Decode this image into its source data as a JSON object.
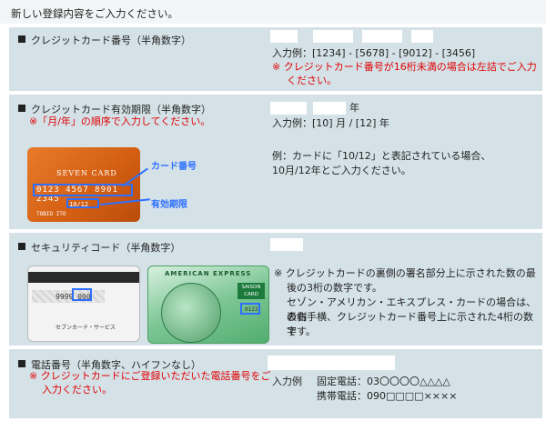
{
  "header": {
    "title": "新しい登録内容をご入力ください。"
  },
  "card_number": {
    "label": "クレジットカード番号（半角数字）",
    "example": "入力例：[1234] - [5678] - [9012] - [3456]",
    "note_line1": "※ クレジットカード番号が16桁未満の場合は左詰でご入力",
    "note_line2": "ください。"
  },
  "expiry": {
    "label": "クレジットカード有効期限（半角数字）",
    "note": "※「月/年」の順序で入力してください。",
    "year_suffix": "年",
    "example": "入力例：[10] 月 / [12] 年",
    "desc_line1": "例：カードに「10/12」と表記されている場合、",
    "desc_line2": "10月/12年とご入力ください。",
    "card": {
      "title": "SEVEN CARD",
      "number": "0123 4567 8901 2345",
      "expiry": "10/12",
      "name": "TOBIO ITO",
      "callout_number": "カード番号",
      "callout_expiry": "有効期限"
    }
  },
  "security": {
    "label": "セキュリティコード（半角数字）",
    "note_line1": "※ クレジットカードの裏側の署名部分上に示された数の最",
    "note_line2": "後の3桁の数字です。",
    "note_line3": "セゾン・アメリカン・エキスプレス・カードの場合は、表側",
    "note_line4": "の右手横、クレジットカード番号上に示された4桁の数字",
    "note_line5": "です。",
    "back_card": {
      "code": "9999 000",
      "brand": "セブンカード・サービス"
    },
    "amex_card": {
      "header": "AMERICAN EXPRESS",
      "saison": "SAISON CARD",
      "code": "0123"
    }
  },
  "phone": {
    "label": "電話番号（半角数字、ハイフンなし）",
    "note_line1": "※ クレジットカードにご登録いただいた電話番号をご",
    "note_line2": "入力ください。",
    "example_label": "入力例",
    "fixed": "固定電話：03〇〇〇〇△△△△",
    "mobile": "携帯電話：090□□□□××××"
  }
}
